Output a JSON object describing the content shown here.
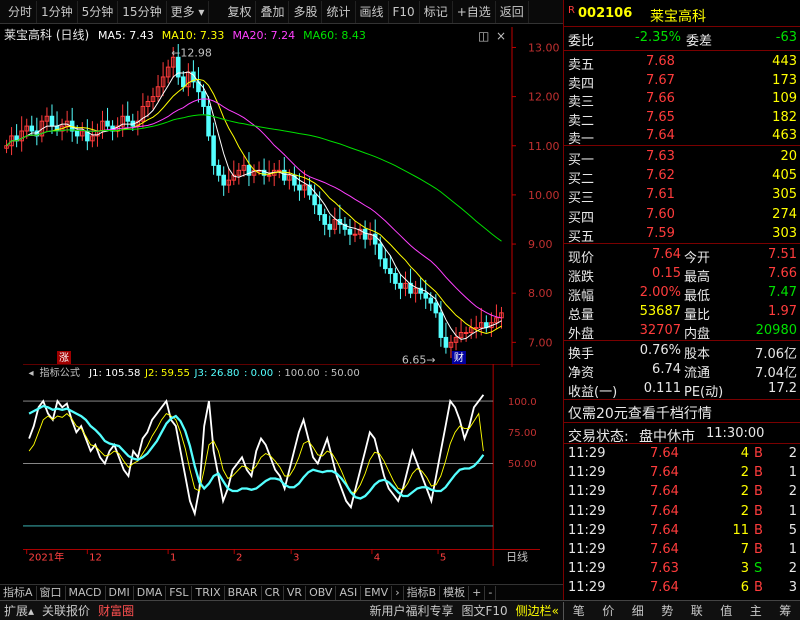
{
  "toolbar": {
    "items": [
      "分时",
      "1分钟",
      "5分钟",
      "15分钟",
      "更多",
      "复权",
      "叠加",
      "多股",
      "统计",
      "画线",
      "F10",
      "标记",
      "自选",
      "返回"
    ]
  },
  "stock": {
    "name_with_period": "莱宝高科 (日线)",
    "code": "002106",
    "name": "莱宝高科",
    "ma_legend": [
      {
        "label": "MA5: 7.43",
        "color": "#ffffff"
      },
      {
        "label": "MA10: 7.33",
        "color": "#ffff00"
      },
      {
        "label": "MA20: 7.24",
        "color": "#ff40ff"
      },
      {
        "label": "MA60: 8.43",
        "color": "#00e000"
      }
    ]
  },
  "colors": {
    "up": "#ff3c3c",
    "down": "#54ffff",
    "ma5": "#ffffff",
    "ma10": "#ffff00",
    "ma20": "#ff40ff",
    "ma60": "#00e000",
    "axis": "#c00000"
  },
  "chart_data": [
    {
      "type": "candlestick",
      "price_ticks": [
        "13.00",
        "12.00",
        "11.00",
        "10.00",
        "9.00",
        "8.00",
        "7.00"
      ],
      "ylim": [
        6.6,
        13.05
      ],
      "annotations": {
        "high": "12.98",
        "low": "6.65",
        "up_marker": "涨",
        "event_marker": "财"
      },
      "closes": [
        11.0,
        11.2,
        11.1,
        11.3,
        11.4,
        11.3,
        11.2,
        11.5,
        11.6,
        11.4,
        11.3,
        11.4,
        11.5,
        11.3,
        11.2,
        11.3,
        11.1,
        11.2,
        11.3,
        11.5,
        11.4,
        11.3,
        11.4,
        11.6,
        11.5,
        11.4,
        11.5,
        11.8,
        11.9,
        12.0,
        12.2,
        12.4,
        12.6,
        12.8,
        12.4,
        12.2,
        12.5,
        12.3,
        12.1,
        11.8,
        11.2,
        10.6,
        10.4,
        10.2,
        10.3,
        10.4,
        10.5,
        10.6,
        10.4,
        10.5,
        10.5,
        10.4,
        10.4,
        10.5,
        10.5,
        10.3,
        10.4,
        10.2,
        10.1,
        10.2,
        10.0,
        9.8,
        9.6,
        9.4,
        9.3,
        9.5,
        9.4,
        9.3,
        9.2,
        9.2,
        9.3,
        9.1,
        9.2,
        9.0,
        8.7,
        8.5,
        8.4,
        8.2,
        8.1,
        8.2,
        8.0,
        8.1,
        8.0,
        7.9,
        7.8,
        7.6,
        7.1,
        6.9,
        7.0,
        7.1,
        7.2,
        7.2,
        7.3,
        7.3,
        7.4,
        7.3,
        7.4,
        7.5,
        7.6
      ],
      "volume_ma": {
        "ma5": "7.43",
        "ma10": "7.33",
        "ma20": "7.24",
        "ma60": "8.43"
      }
    },
    {
      "type": "line",
      "title": "指标公式",
      "legend": [
        {
          "label": "J1: 105.58",
          "color": "#ffffff"
        },
        {
          "label": "J2: 59.55",
          "color": "#ffff00"
        },
        {
          "label": "J3: 26.80",
          "color": "#54ffff"
        },
        {
          "label": ": 0.00",
          "color": "#54ffff"
        },
        {
          "label": ": 100.00",
          "color": "#c0c0c0"
        },
        {
          "label": ": 50.00",
          "color": "#c0c0c0"
        }
      ],
      "y_ticks": [
        "100.0",
        "75.00",
        "50.00"
      ],
      "ylim": [
        -10,
        115
      ],
      "x_labels": [
        "2021年",
        "12",
        "1",
        "2",
        "3",
        "4",
        "5"
      ],
      "series": [
        {
          "values": [
            70,
            80,
            95,
            100,
            90,
            85,
            100,
            95,
            98,
            85,
            75,
            80,
            70,
            60,
            65,
            55,
            50,
            60,
            65,
            55,
            45,
            40,
            60,
            55,
            70,
            75,
            85,
            90,
            95,
            100,
            85,
            80,
            60,
            40,
            20,
            10,
            30,
            80,
            100,
            60,
            40,
            20,
            30,
            45,
            50,
            55,
            45,
            40,
            60,
            70,
            65,
            55,
            45,
            40,
            30,
            45,
            60,
            75,
            85,
            70,
            55,
            50,
            60,
            70,
            55,
            40,
            30,
            20,
            15,
            30,
            45,
            60,
            75,
            70,
            55,
            40,
            30,
            25,
            20,
            30,
            45,
            60,
            50,
            40,
            30,
            20,
            40,
            60,
            80,
            100,
            95,
            85,
            70,
            80,
            95,
            100,
            105
          ]
        },
        {
          "values": [
            60,
            65,
            75,
            85,
            88,
            85,
            88,
            87,
            90,
            86,
            80,
            78,
            72,
            65,
            64,
            60,
            56,
            57,
            60,
            58,
            52,
            47,
            50,
            52,
            58,
            64,
            72,
            78,
            85,
            90,
            88,
            85,
            75,
            62,
            45,
            30,
            28,
            45,
            65,
            68,
            60,
            45,
            38,
            40,
            44,
            48,
            47,
            44,
            48,
            55,
            58,
            56,
            52,
            47,
            40,
            40,
            46,
            55,
            66,
            68,
            63,
            57,
            56,
            60,
            58,
            52,
            44,
            35,
            27,
            27,
            33,
            42,
            53,
            59,
            58,
            52,
            44,
            36,
            30,
            29,
            34,
            42,
            46,
            44,
            39,
            32,
            33,
            40,
            52,
            66,
            75,
            80,
            78,
            78,
            84,
            90,
            60
          ]
        },
        {
          "values": [
            90,
            92,
            94,
            96,
            95,
            93,
            94,
            93,
            94,
            92,
            90,
            88,
            85,
            80,
            77,
            73,
            68,
            66,
            65,
            64,
            60,
            56,
            54,
            53,
            55,
            58,
            63,
            68,
            75,
            82,
            86,
            88,
            84,
            76,
            64,
            48,
            35,
            30,
            34,
            40,
            42,
            36,
            30,
            28,
            28,
            30,
            30,
            29,
            30,
            33,
            36,
            38,
            38,
            37,
            33,
            31,
            31,
            34,
            39,
            43,
            45,
            44,
            43,
            44,
            44,
            42,
            38,
            33,
            27,
            23,
            22,
            24,
            28,
            33,
            36,
            37,
            35,
            31,
            27,
            24,
            24,
            27,
            30,
            31,
            31,
            29,
            28,
            28,
            31,
            36,
            41,
            45,
            46,
            46,
            48,
            52,
            57
          ]
        }
      ]
    }
  ],
  "quote": {
    "weibi_label": "委比",
    "weibi_value": "-2.35%",
    "weicha_label": "委差",
    "weicha_value": "-63",
    "asks": [
      {
        "label": "卖五",
        "price": "7.68",
        "vol": "443"
      },
      {
        "label": "卖四",
        "price": "7.67",
        "vol": "173"
      },
      {
        "label": "卖三",
        "price": "7.66",
        "vol": "109"
      },
      {
        "label": "卖二",
        "price": "7.65",
        "vol": "182"
      },
      {
        "label": "卖一",
        "price": "7.64",
        "vol": "463"
      }
    ],
    "bids": [
      {
        "label": "买一",
        "price": "7.63",
        "vol": "20"
      },
      {
        "label": "买二",
        "price": "7.62",
        "vol": "405"
      },
      {
        "label": "买三",
        "price": "7.61",
        "vol": "305"
      },
      {
        "label": "买四",
        "price": "7.60",
        "vol": "274"
      },
      {
        "label": "买五",
        "price": "7.59",
        "vol": "303"
      }
    ],
    "stats": [
      {
        "l1": "现价",
        "v1": "7.64",
        "c1": "red",
        "l2": "今开",
        "v2": "7.51",
        "c2": "red"
      },
      {
        "l1": "涨跌",
        "v1": "0.15",
        "c1": "red",
        "l2": "最高",
        "v2": "7.66",
        "c2": "red"
      },
      {
        "l1": "涨幅",
        "v1": "2.00%",
        "c1": "red",
        "l2": "最低",
        "v2": "7.47",
        "c2": "grn"
      },
      {
        "l1": "总量",
        "v1": "53687",
        "c1": "yel",
        "l2": "量比",
        "v2": "1.97",
        "c2": "red"
      },
      {
        "l1": "外盘",
        "v1": "32707",
        "c1": "red",
        "l2": "内盘",
        "v2": "20980",
        "c2": "grn"
      }
    ],
    "fund": [
      {
        "l1": "换手",
        "v1": "0.76%",
        "l2": "股本",
        "v2": "7.06亿"
      },
      {
        "l1": "净资",
        "v1": "6.74",
        "l2": "流通",
        "v2": "7.04亿"
      },
      {
        "l1": "收益(一)",
        "v1": "0.111",
        "l2": "PE(动)",
        "v2": "17.2"
      }
    ],
    "promo": "仅需20元查看千档行情",
    "trade_state_label": "交易状态:",
    "trade_state": "盘中休市",
    "trade_time": "11:30:00",
    "ticks": [
      {
        "time": "11:29",
        "price": "7.64",
        "vol": "4",
        "bs": "B",
        "n": "2"
      },
      {
        "time": "11:29",
        "price": "7.64",
        "vol": "2",
        "bs": "B",
        "n": "1"
      },
      {
        "time": "11:29",
        "price": "7.64",
        "vol": "2",
        "bs": "B",
        "n": "2"
      },
      {
        "time": "11:29",
        "price": "7.64",
        "vol": "2",
        "bs": "B",
        "n": "1"
      },
      {
        "time": "11:29",
        "price": "7.64",
        "vol": "11",
        "bs": "B",
        "n": "5"
      },
      {
        "time": "11:29",
        "price": "7.64",
        "vol": "7",
        "bs": "B",
        "n": "1"
      },
      {
        "time": "11:29",
        "price": "7.63",
        "vol": "3",
        "bs": "S",
        "n": "2"
      },
      {
        "time": "11:29",
        "price": "7.64",
        "vol": "6",
        "bs": "B",
        "n": "3"
      }
    ]
  },
  "tabs": [
    "指标A",
    "窗口",
    "MACD",
    "DMI",
    "DMA",
    "FSL",
    "TRIX",
    "BRAR",
    "CR",
    "VR",
    "OBV",
    "ASI",
    "EMV",
    "指标B",
    "模板",
    "+",
    "-",
    "日线"
  ],
  "statusbar": {
    "left": [
      "扩展",
      "关联报价",
      "财富圈"
    ],
    "middle": [
      "新用户福利专享",
      "图文F10",
      "侧边栏"
    ],
    "right": [
      "笔",
      "价",
      "细",
      "势",
      "联",
      "值",
      "主",
      "筹"
    ]
  }
}
